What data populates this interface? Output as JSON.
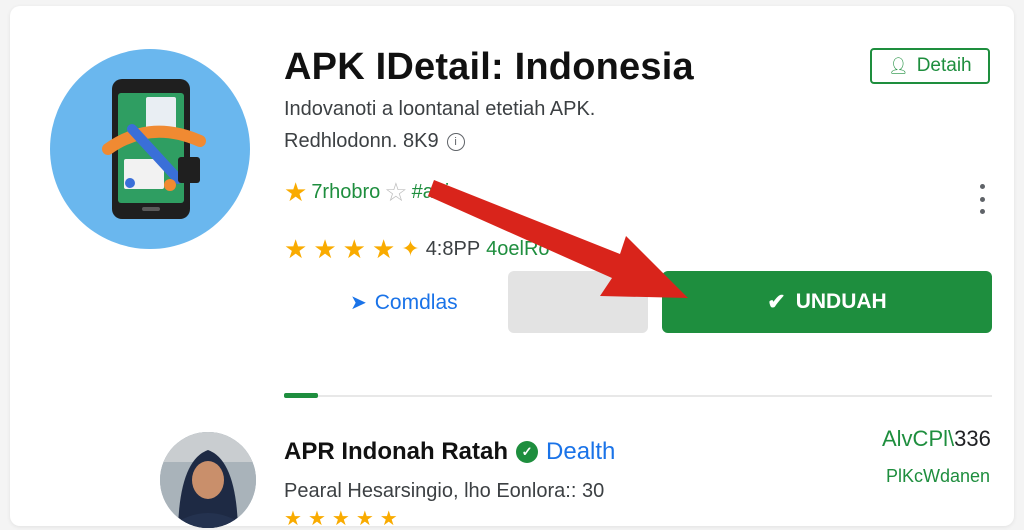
{
  "app": {
    "title": "APK IDetail: Indonesia",
    "subtitle": "Indovanoti a loontanal  etetiah APK.",
    "developer": "Redhlodonn. 8K9",
    "detail_button": "Detaih",
    "rating_text": "7rhobro",
    "tag_text": "#aui",
    "rating_summary": "4:8PP",
    "downloads_text": "4oelRo",
    "share_label": "Comdlas",
    "install_label": "UNDUAH",
    "icon_name": "app-phone-icon"
  },
  "review": {
    "name": "APR Indonah Ratah",
    "verified_label": "Dealth",
    "meta": "Pearal Hesarsingio, lho Eonlora:: 30",
    "side_count_green": "AlvCPl\\",
    "side_count_dark": "336",
    "side_label": "PlKcWdanen"
  },
  "colors": {
    "accent_green": "#1e8e3e",
    "link_blue": "#1a73e8",
    "star_gold": "#f9ab00",
    "arrow_red": "#d9241b",
    "icon_bg": "#6ab7ee"
  }
}
